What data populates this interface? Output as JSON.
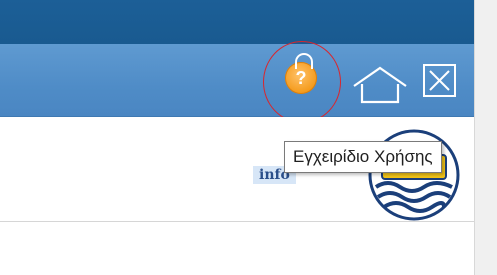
{
  "header": {
    "help_button": {
      "icon": "help-icon",
      "glyph": "?",
      "tooltip": "Εγχειρίδιο Χρήσης"
    },
    "home_button": {
      "icon": "home-icon"
    },
    "close_button": {
      "icon": "close-icon"
    }
  },
  "content": {
    "info_label": "info"
  },
  "colors": {
    "top_bar": "#1c5f97",
    "header_bar": "#5b97d0",
    "help_icon": "#f49a1a",
    "highlight_circle": "#d9262d"
  }
}
